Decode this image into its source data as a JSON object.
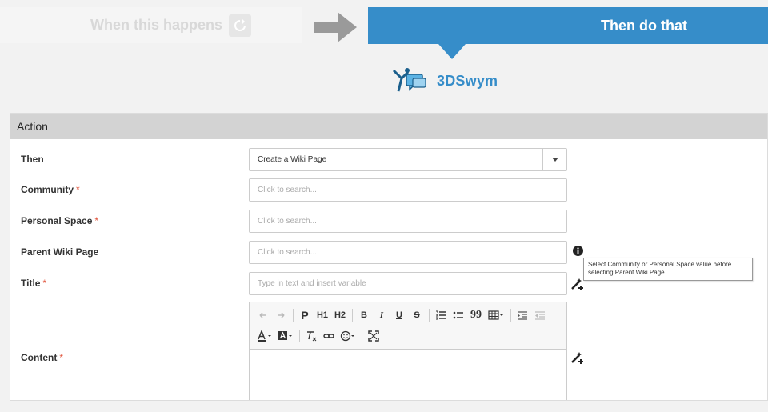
{
  "header": {
    "when_label": "When this happens",
    "then_label": "Then do that"
  },
  "app": {
    "name": "3DSwym"
  },
  "panel": {
    "title": "Action"
  },
  "form": {
    "then": {
      "label": "Then",
      "value": "Create a Wiki Page"
    },
    "community": {
      "label": "Community",
      "placeholder": "Click to search..."
    },
    "personal_space": {
      "label": "Personal Space",
      "placeholder": "Click to search..."
    },
    "parent_wiki_page": {
      "label": "Parent Wiki Page",
      "placeholder": "Click to search..."
    },
    "title": {
      "label": "Title",
      "placeholder": "Type in text and insert variable"
    },
    "content": {
      "label": "Content"
    },
    "required_mark": "*"
  },
  "tooltip": {
    "text": "Select Community or Personal Space value before selecting Parent Wiki Page"
  },
  "toolbar": {
    "paragraph": "P",
    "h1": "H1",
    "h2": "H2",
    "bold": "B",
    "italic": "I",
    "underline": "U",
    "strike": "S",
    "quote": "99"
  },
  "colors": {
    "accent": "#368dc9",
    "required": "#e0523a",
    "panel_header": "#d3d3d3"
  }
}
